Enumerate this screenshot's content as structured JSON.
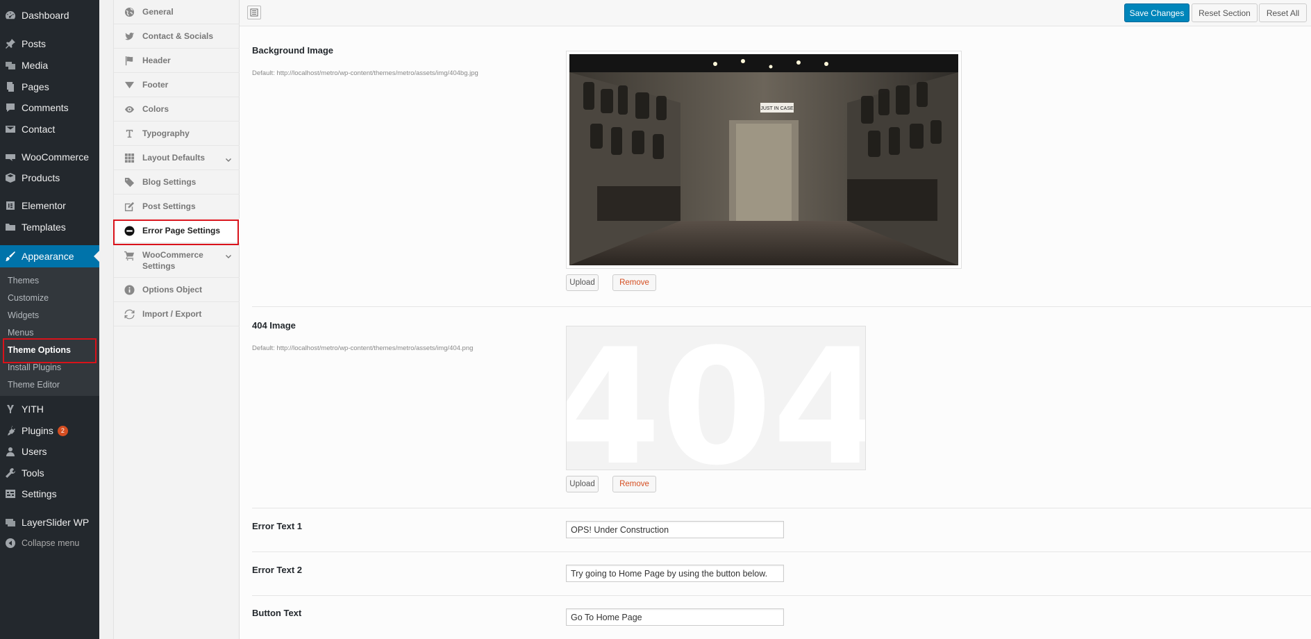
{
  "sidebar": {
    "items": [
      {
        "label": "Dashboard",
        "icon": "dashboard-icon"
      },
      {
        "label": "Posts",
        "icon": "pin-icon"
      },
      {
        "label": "Media",
        "icon": "media-icon"
      },
      {
        "label": "Pages",
        "icon": "pages-icon"
      },
      {
        "label": "Comments",
        "icon": "comment-icon"
      },
      {
        "label": "Contact",
        "icon": "mail-icon"
      },
      {
        "label": "WooCommerce",
        "icon": "woocommerce-icon"
      },
      {
        "label": "Products",
        "icon": "box-icon"
      },
      {
        "label": "Elementor",
        "icon": "elementor-icon"
      },
      {
        "label": "Templates",
        "icon": "folder-icon"
      },
      {
        "label": "Appearance",
        "icon": "brush-icon"
      },
      {
        "label": "YITH",
        "icon": "yith-icon"
      },
      {
        "label": "Plugins",
        "icon": "plug-icon",
        "badge": "2"
      },
      {
        "label": "Users",
        "icon": "user-icon"
      },
      {
        "label": "Tools",
        "icon": "wrench-icon"
      },
      {
        "label": "Settings",
        "icon": "settings-icon"
      },
      {
        "label": "LayerSlider WP",
        "icon": "layers-icon"
      }
    ],
    "submenu": [
      "Themes",
      "Customize",
      "Widgets",
      "Menus",
      "Theme Options",
      "Install Plugins",
      "Theme Editor"
    ],
    "collapse_label": "Collapse menu",
    "active_color": "#0073aa",
    "highlight_color": "#d9121a"
  },
  "panel_nav": {
    "items": [
      {
        "label": "General",
        "icon": "globe-icon"
      },
      {
        "label": "Contact & Socials",
        "icon": "twitter-icon"
      },
      {
        "label": "Header",
        "icon": "flag-icon"
      },
      {
        "label": "Footer",
        "icon": "funnel-icon"
      },
      {
        "label": "Colors",
        "icon": "eye-icon"
      },
      {
        "label": "Typography",
        "icon": "text-icon"
      },
      {
        "label": "Layout Defaults",
        "icon": "grid-icon"
      },
      {
        "label": "Blog Settings",
        "icon": "tags-icon"
      },
      {
        "label": "Post Settings",
        "icon": "edit-icon"
      },
      {
        "label": "Error Page Settings",
        "icon": "minus-circle-icon"
      },
      {
        "label": "WooCommerce Settings",
        "icon": "cart-icon"
      },
      {
        "label": "Options Object",
        "icon": "info-icon"
      },
      {
        "label": "Import / Export",
        "icon": "refresh-icon"
      }
    ]
  },
  "toolbar": {
    "save_label": "Save Changes",
    "reset_section_label": "Reset Section",
    "reset_all_label": "Reset All",
    "primary_color": "#0085ba"
  },
  "fields": {
    "background_image": {
      "title": "Background Image",
      "desc": "Default: http://localhost/metro/wp-content/themes/metro/assets/img/404bg.jpg",
      "upload_label": "Upload",
      "remove_label": "Remove",
      "preview_text": "JUST IN CASE"
    },
    "image_404": {
      "title": "404 Image",
      "desc": "Default: http://localhost/metro/wp-content/themes/metro/assets/img/404.png",
      "upload_label": "Upload",
      "remove_label": "Remove",
      "preview_text": "404"
    },
    "error_text_1": {
      "title": "Error Text 1",
      "value": "OPS! Under Construction"
    },
    "error_text_2": {
      "title": "Error Text 2",
      "value": "Try going to Home Page by using the button below."
    },
    "button_text": {
      "title": "Button Text",
      "value": "Go To Home Page"
    }
  }
}
